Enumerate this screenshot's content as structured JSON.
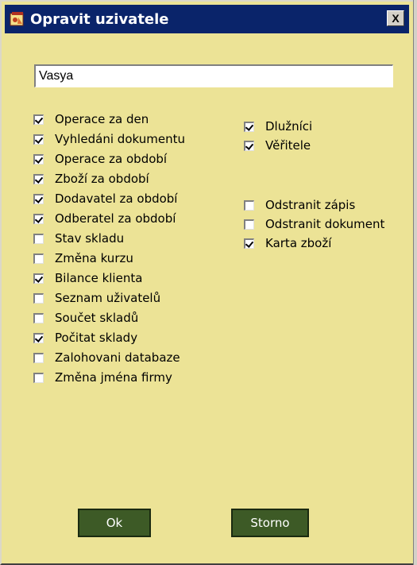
{
  "window": {
    "title": "Opravit uzivatele",
    "close_glyph": "X"
  },
  "name_field": {
    "value": "Vasya"
  },
  "permissions_left": [
    {
      "label": "Operace za den",
      "checked": true
    },
    {
      "label": "Vyhledáni dokumentu",
      "checked": true
    },
    {
      "label": "Operace za období",
      "checked": true
    },
    {
      "label": "Zboží za období",
      "checked": true
    },
    {
      "label": "Dodavatel za období",
      "checked": true
    },
    {
      "label": "Odberatel za období",
      "checked": true
    },
    {
      "label": "Stav skladu",
      "checked": false
    },
    {
      "label": "Změna kurzu",
      "checked": false
    },
    {
      "label": "Bilance klienta",
      "checked": true
    },
    {
      "label": "Seznam uživatelů",
      "checked": false
    },
    {
      "label": "Součet skladů",
      "checked": false
    },
    {
      "label": "Počitat sklady",
      "checked": true
    },
    {
      "label": "Zalohovani databaze",
      "checked": false
    },
    {
      "label": "Změna jména firmy",
      "checked": false
    }
  ],
  "permissions_right": [
    {
      "label": "Dlužníci",
      "checked": true
    },
    {
      "label": "Věřitele",
      "checked": true
    },
    {
      "label": "Odstranit zápis",
      "checked": false
    },
    {
      "label": "Odstranit dokument",
      "checked": false
    },
    {
      "label": "Karta zboží",
      "checked": true
    }
  ],
  "buttons": {
    "ok": "Ok",
    "cancel": "Storno"
  },
  "colors": {
    "titlebar": "#0a246a",
    "background": "#ece396",
    "button": "#3d5a26"
  }
}
